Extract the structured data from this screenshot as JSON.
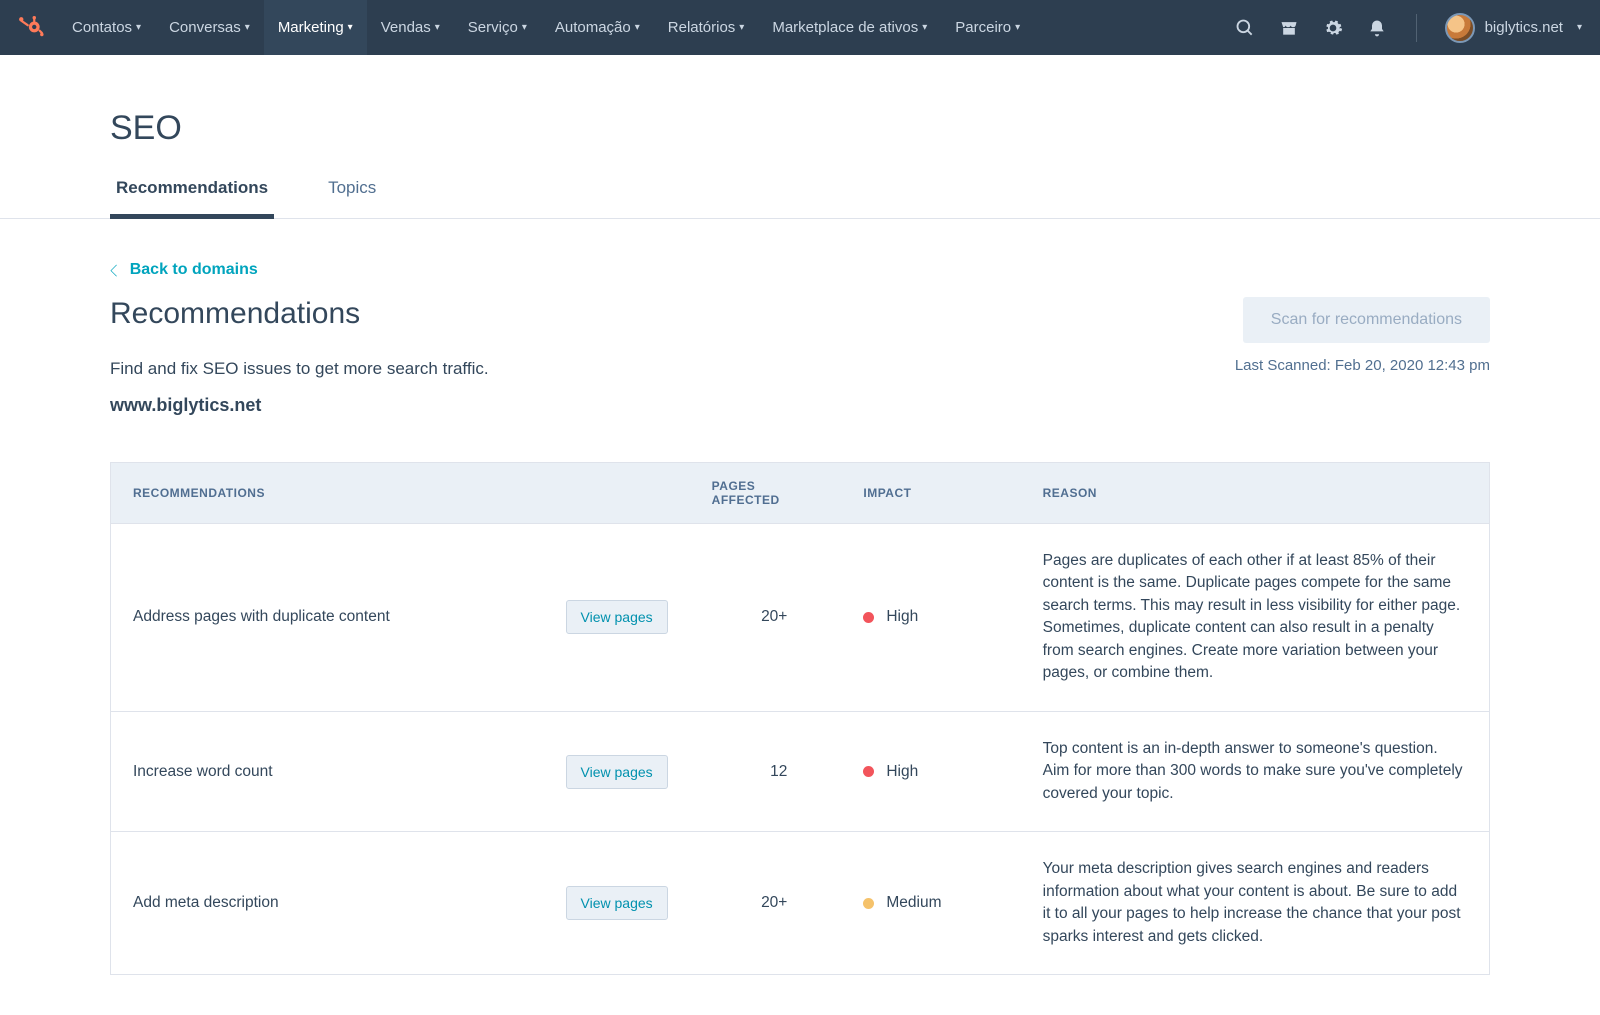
{
  "nav": {
    "items": [
      {
        "label": "Contatos"
      },
      {
        "label": "Conversas"
      },
      {
        "label": "Marketing",
        "active": true
      },
      {
        "label": "Vendas"
      },
      {
        "label": "Serviço"
      },
      {
        "label": "Automação"
      },
      {
        "label": "Relatórios"
      },
      {
        "label": "Marketplace de ativos"
      },
      {
        "label": "Parceiro"
      }
    ],
    "account_label": "biglytics.net"
  },
  "page": {
    "title": "SEO",
    "tabs": [
      {
        "label": "Recommendations",
        "active": true
      },
      {
        "label": "Topics"
      }
    ],
    "back_label": "Back to domains",
    "section_title": "Recommendations",
    "section_sub": "Find and fix SEO issues to get more search traffic.",
    "domain": "www.biglytics.net",
    "scan_button": "Scan for recommendations",
    "last_scanned": "Last Scanned: Feb 20, 2020 12:43 pm"
  },
  "table": {
    "headers": {
      "recommendations": "RECOMMENDATIONS",
      "pages_affected": "PAGES AFFECTED",
      "impact": "IMPACT",
      "reason": "REASON"
    },
    "view_pages_label": "View pages",
    "rows": [
      {
        "name": "Address pages with duplicate content",
        "pages": "20+",
        "impact": "High",
        "impact_level": "high",
        "reason": "Pages are duplicates of each other if at least 85% of their content is the same. Duplicate pages compete for the same search terms. This may result in less visibility for either page. Sometimes, duplicate content can also result in a penalty from search engines. Create more variation between your pages, or combine them."
      },
      {
        "name": "Increase word count",
        "pages": "12",
        "impact": "High",
        "impact_level": "high",
        "reason": "Top content is an in-depth answer to someone's question. Aim for more than 300 words to make sure you've completely covered your topic."
      },
      {
        "name": "Add meta description",
        "pages": "20+",
        "impact": "Medium",
        "impact_level": "medium",
        "reason": "Your meta description gives search engines and readers information about what your content is about. Be sure to add it to all your pages to help increase the chance that your post sparks interest and gets clicked."
      }
    ]
  }
}
